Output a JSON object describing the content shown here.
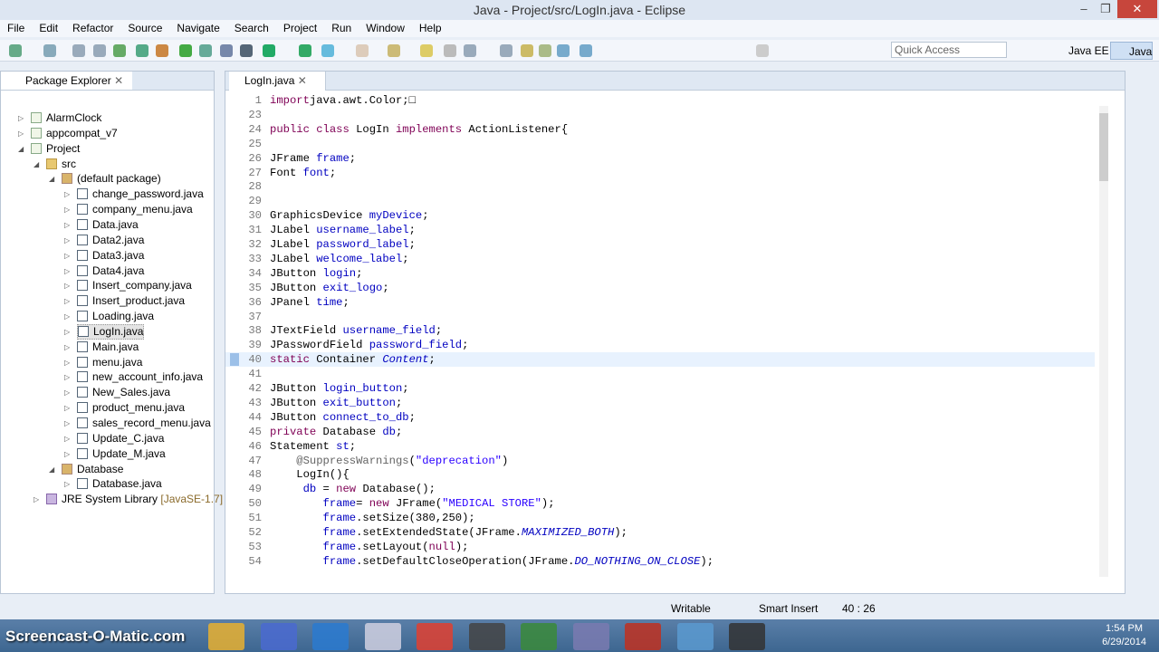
{
  "window": {
    "title": "Java - Project/src/LogIn.java - Eclipse",
    "min": "–",
    "max": "❐",
    "close": "✕"
  },
  "menu": [
    "File",
    "Edit",
    "Refactor",
    "Source",
    "Navigate",
    "Search",
    "Project",
    "Run",
    "Window",
    "Help"
  ],
  "toolbar": {
    "quick_access": "Quick Access",
    "perspectives": [
      "Java EE",
      "Java"
    ]
  },
  "package_explorer": {
    "title": "Package Explorer",
    "items": [
      {
        "label": "AlarmClock",
        "depth": 0,
        "twisty": "▷",
        "icon": "project"
      },
      {
        "label": "appcompat_v7",
        "depth": 0,
        "twisty": "▷",
        "icon": "project"
      },
      {
        "label": "Project",
        "depth": 0,
        "twisty": "◢",
        "icon": "project"
      },
      {
        "label": "src",
        "depth": 1,
        "twisty": "◢",
        "icon": "folder"
      },
      {
        "label": "(default package)",
        "depth": 2,
        "twisty": "◢",
        "icon": "package"
      },
      {
        "label": "change_password.java",
        "depth": 3,
        "twisty": "▷",
        "icon": "java"
      },
      {
        "label": "company_menu.java",
        "depth": 3,
        "twisty": "▷",
        "icon": "java"
      },
      {
        "label": "Data.java",
        "depth": 3,
        "twisty": "▷",
        "icon": "java"
      },
      {
        "label": "Data2.java",
        "depth": 3,
        "twisty": "▷",
        "icon": "java"
      },
      {
        "label": "Data3.java",
        "depth": 3,
        "twisty": "▷",
        "icon": "java"
      },
      {
        "label": "Data4.java",
        "depth": 3,
        "twisty": "▷",
        "icon": "java"
      },
      {
        "label": "Insert_company.java",
        "depth": 3,
        "twisty": "▷",
        "icon": "java"
      },
      {
        "label": "Insert_product.java",
        "depth": 3,
        "twisty": "▷",
        "icon": "java"
      },
      {
        "label": "Loading.java",
        "depth": 3,
        "twisty": "▷",
        "icon": "java"
      },
      {
        "label": "LogIn.java",
        "depth": 3,
        "twisty": "▷",
        "icon": "java",
        "selected": true
      },
      {
        "label": "Main.java",
        "depth": 3,
        "twisty": "▷",
        "icon": "java"
      },
      {
        "label": "menu.java",
        "depth": 3,
        "twisty": "▷",
        "icon": "java"
      },
      {
        "label": "new_account_info.java",
        "depth": 3,
        "twisty": "▷",
        "icon": "java"
      },
      {
        "label": "New_Sales.java",
        "depth": 3,
        "twisty": "▷",
        "icon": "java"
      },
      {
        "label": "product_menu.java",
        "depth": 3,
        "twisty": "▷",
        "icon": "java"
      },
      {
        "label": "sales_record_menu.java",
        "depth": 3,
        "twisty": "▷",
        "icon": "java"
      },
      {
        "label": "Update_C.java",
        "depth": 3,
        "twisty": "▷",
        "icon": "java"
      },
      {
        "label": "Update_M.java",
        "depth": 3,
        "twisty": "▷",
        "icon": "java"
      },
      {
        "label": "Database",
        "depth": 2,
        "twisty": "◢",
        "icon": "package"
      },
      {
        "label": "Database.java",
        "depth": 3,
        "twisty": "▷",
        "icon": "java"
      },
      {
        "label": "JRE System Library",
        "suffix": " [JavaSE-1.7]",
        "depth": 1,
        "twisty": "▷",
        "icon": "library"
      }
    ]
  },
  "editor": {
    "tab": "LogIn.java",
    "lines": [
      {
        "n": "1",
        "t": [
          [
            "kw",
            "import"
          ],
          [
            "",
            "java.awt.Color;□"
          ]
        ]
      },
      {
        "n": "23",
        "t": []
      },
      {
        "n": "24",
        "t": [
          [
            "kw",
            "public class"
          ],
          [
            "",
            " LogIn "
          ],
          [
            "kw",
            "implements"
          ],
          [
            "",
            " ActionListener{"
          ]
        ]
      },
      {
        "n": "25",
        "t": []
      },
      {
        "n": "26",
        "t": [
          [
            "",
            "JFrame "
          ],
          [
            "fld",
            "frame"
          ],
          [
            "",
            ";"
          ]
        ]
      },
      {
        "n": "27",
        "t": [
          [
            "",
            "Font "
          ],
          [
            "fld",
            "font"
          ],
          [
            "",
            ";"
          ]
        ]
      },
      {
        "n": "28",
        "t": []
      },
      {
        "n": "29",
        "t": []
      },
      {
        "n": "30",
        "t": [
          [
            "",
            "GraphicsDevice "
          ],
          [
            "fld",
            "myDevice"
          ],
          [
            "",
            ";"
          ]
        ]
      },
      {
        "n": "31",
        "t": [
          [
            "",
            "JLabel "
          ],
          [
            "fld",
            "username_label"
          ],
          [
            "",
            ";"
          ]
        ]
      },
      {
        "n": "32",
        "t": [
          [
            "",
            "JLabel "
          ],
          [
            "fld",
            "password_label"
          ],
          [
            "",
            ";"
          ]
        ]
      },
      {
        "n": "33",
        "t": [
          [
            "",
            "JLabel "
          ],
          [
            "fld",
            "welcome_label"
          ],
          [
            "",
            ";"
          ]
        ]
      },
      {
        "n": "34",
        "t": [
          [
            "",
            "JButton "
          ],
          [
            "fld",
            "login"
          ],
          [
            "",
            ";"
          ]
        ]
      },
      {
        "n": "35",
        "t": [
          [
            "",
            "JButton "
          ],
          [
            "fld",
            "exit_logo"
          ],
          [
            "",
            ";"
          ]
        ]
      },
      {
        "n": "36",
        "t": [
          [
            "",
            "JPanel "
          ],
          [
            "fld",
            "time"
          ],
          [
            "",
            ";"
          ]
        ]
      },
      {
        "n": "37",
        "t": []
      },
      {
        "n": "38",
        "t": [
          [
            "",
            "JTextField "
          ],
          [
            "fld",
            "username_field"
          ],
          [
            "",
            ";"
          ]
        ]
      },
      {
        "n": "39",
        "t": [
          [
            "",
            "JPasswordField "
          ],
          [
            "fld",
            "password_field"
          ],
          [
            "",
            ";"
          ]
        ]
      },
      {
        "n": "40",
        "t": [
          [
            "kw",
            "static"
          ],
          [
            "",
            " Container "
          ],
          [
            "st",
            "Content"
          ],
          [
            "",
            ";"
          ]
        ],
        "current": true
      },
      {
        "n": "41",
        "t": []
      },
      {
        "n": "42",
        "t": [
          [
            "",
            "JButton "
          ],
          [
            "fld",
            "login_button"
          ],
          [
            "",
            ";"
          ]
        ]
      },
      {
        "n": "43",
        "t": [
          [
            "",
            "JButton "
          ],
          [
            "fld",
            "exit_button"
          ],
          [
            "",
            ";"
          ]
        ]
      },
      {
        "n": "44",
        "t": [
          [
            "",
            "JButton "
          ],
          [
            "fld",
            "connect_to_db"
          ],
          [
            "",
            ";"
          ]
        ]
      },
      {
        "n": "45",
        "t": [
          [
            "kw",
            "private"
          ],
          [
            "",
            " Database "
          ],
          [
            "fld",
            "db"
          ],
          [
            "",
            ";"
          ]
        ]
      },
      {
        "n": "46",
        "t": [
          [
            "",
            "Statement "
          ],
          [
            "fld",
            "st"
          ],
          [
            "",
            ";"
          ]
        ]
      },
      {
        "n": "47",
        "t": [
          [
            "ann",
            "    @SuppressWarnings"
          ],
          [
            "",
            "("
          ],
          [
            "str",
            "\"deprecation\""
          ],
          [
            "",
            ")"
          ]
        ]
      },
      {
        "n": "48",
        "t": [
          [
            "",
            "    LogIn(){"
          ]
        ]
      },
      {
        "n": "49",
        "t": [
          [
            "",
            "     "
          ],
          [
            "fld",
            "db"
          ],
          [
            "",
            " = "
          ],
          [
            "kw",
            "new"
          ],
          [
            "",
            " Database();"
          ]
        ]
      },
      {
        "n": "50",
        "t": [
          [
            "",
            "        "
          ],
          [
            "fld",
            "frame"
          ],
          [
            "",
            "= "
          ],
          [
            "kw",
            "new"
          ],
          [
            "",
            " JFrame("
          ],
          [
            "str",
            "\"MEDICAL STORE\""
          ],
          [
            "",
            ");"
          ]
        ]
      },
      {
        "n": "51",
        "t": [
          [
            "",
            "        "
          ],
          [
            "fld",
            "frame"
          ],
          [
            "",
            ".setSize(380,250);"
          ]
        ]
      },
      {
        "n": "52",
        "t": [
          [
            "",
            "        "
          ],
          [
            "fld",
            "frame"
          ],
          [
            "",
            ".setExtendedState(JFrame."
          ],
          [
            "st",
            "MAXIMIZED_BOTH"
          ],
          [
            "",
            ");"
          ]
        ]
      },
      {
        "n": "53",
        "t": [
          [
            "",
            "        "
          ],
          [
            "fld",
            "frame"
          ],
          [
            "",
            ".setLayout("
          ],
          [
            "kw",
            "null"
          ],
          [
            "",
            ");"
          ]
        ]
      },
      {
        "n": "54",
        "t": [
          [
            "",
            "        "
          ],
          [
            "fld",
            "frame"
          ],
          [
            "",
            ".setDefaultCloseOperation(JFrame."
          ],
          [
            "st",
            "DO_NOTHING_ON_CLOSE"
          ],
          [
            "",
            ");"
          ]
        ]
      }
    ]
  },
  "status": {
    "writable": "Writable",
    "insert_mode": "Smart Insert",
    "position": "40 : 26"
  },
  "taskbar": {
    "brand": "Screencast-O-Matic.com",
    "time": "1:54 PM",
    "date": "6/29/2014"
  }
}
